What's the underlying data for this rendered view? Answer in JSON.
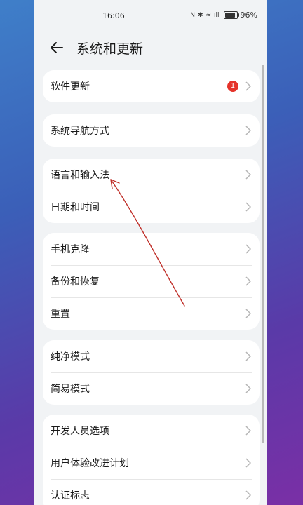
{
  "status_bar": {
    "time": "16:06",
    "nfc": "N",
    "bluetooth": "✱",
    "wifi": "≈",
    "signal": "ıll",
    "battery": "96%"
  },
  "header": {
    "title": "系统和更新"
  },
  "groups": [
    {
      "items": [
        {
          "label": "软件更新",
          "badge": "1"
        }
      ]
    },
    {
      "items": [
        {
          "label": "系统导航方式"
        }
      ]
    },
    {
      "items": [
        {
          "label": "语言和输入法"
        },
        {
          "label": "日期和时间"
        }
      ]
    },
    {
      "items": [
        {
          "label": "手机克隆"
        },
        {
          "label": "备份和恢复"
        },
        {
          "label": "重置"
        }
      ]
    },
    {
      "items": [
        {
          "label": "纯净模式"
        },
        {
          "label": "简易模式"
        }
      ]
    },
    {
      "items": [
        {
          "label": "开发人员选项"
        },
        {
          "label": "用户体验改进计划"
        },
        {
          "label": "认证标志"
        }
      ]
    }
  ],
  "colors": {
    "badge": "#e5332a",
    "annotation_line": "#c0302a"
  }
}
